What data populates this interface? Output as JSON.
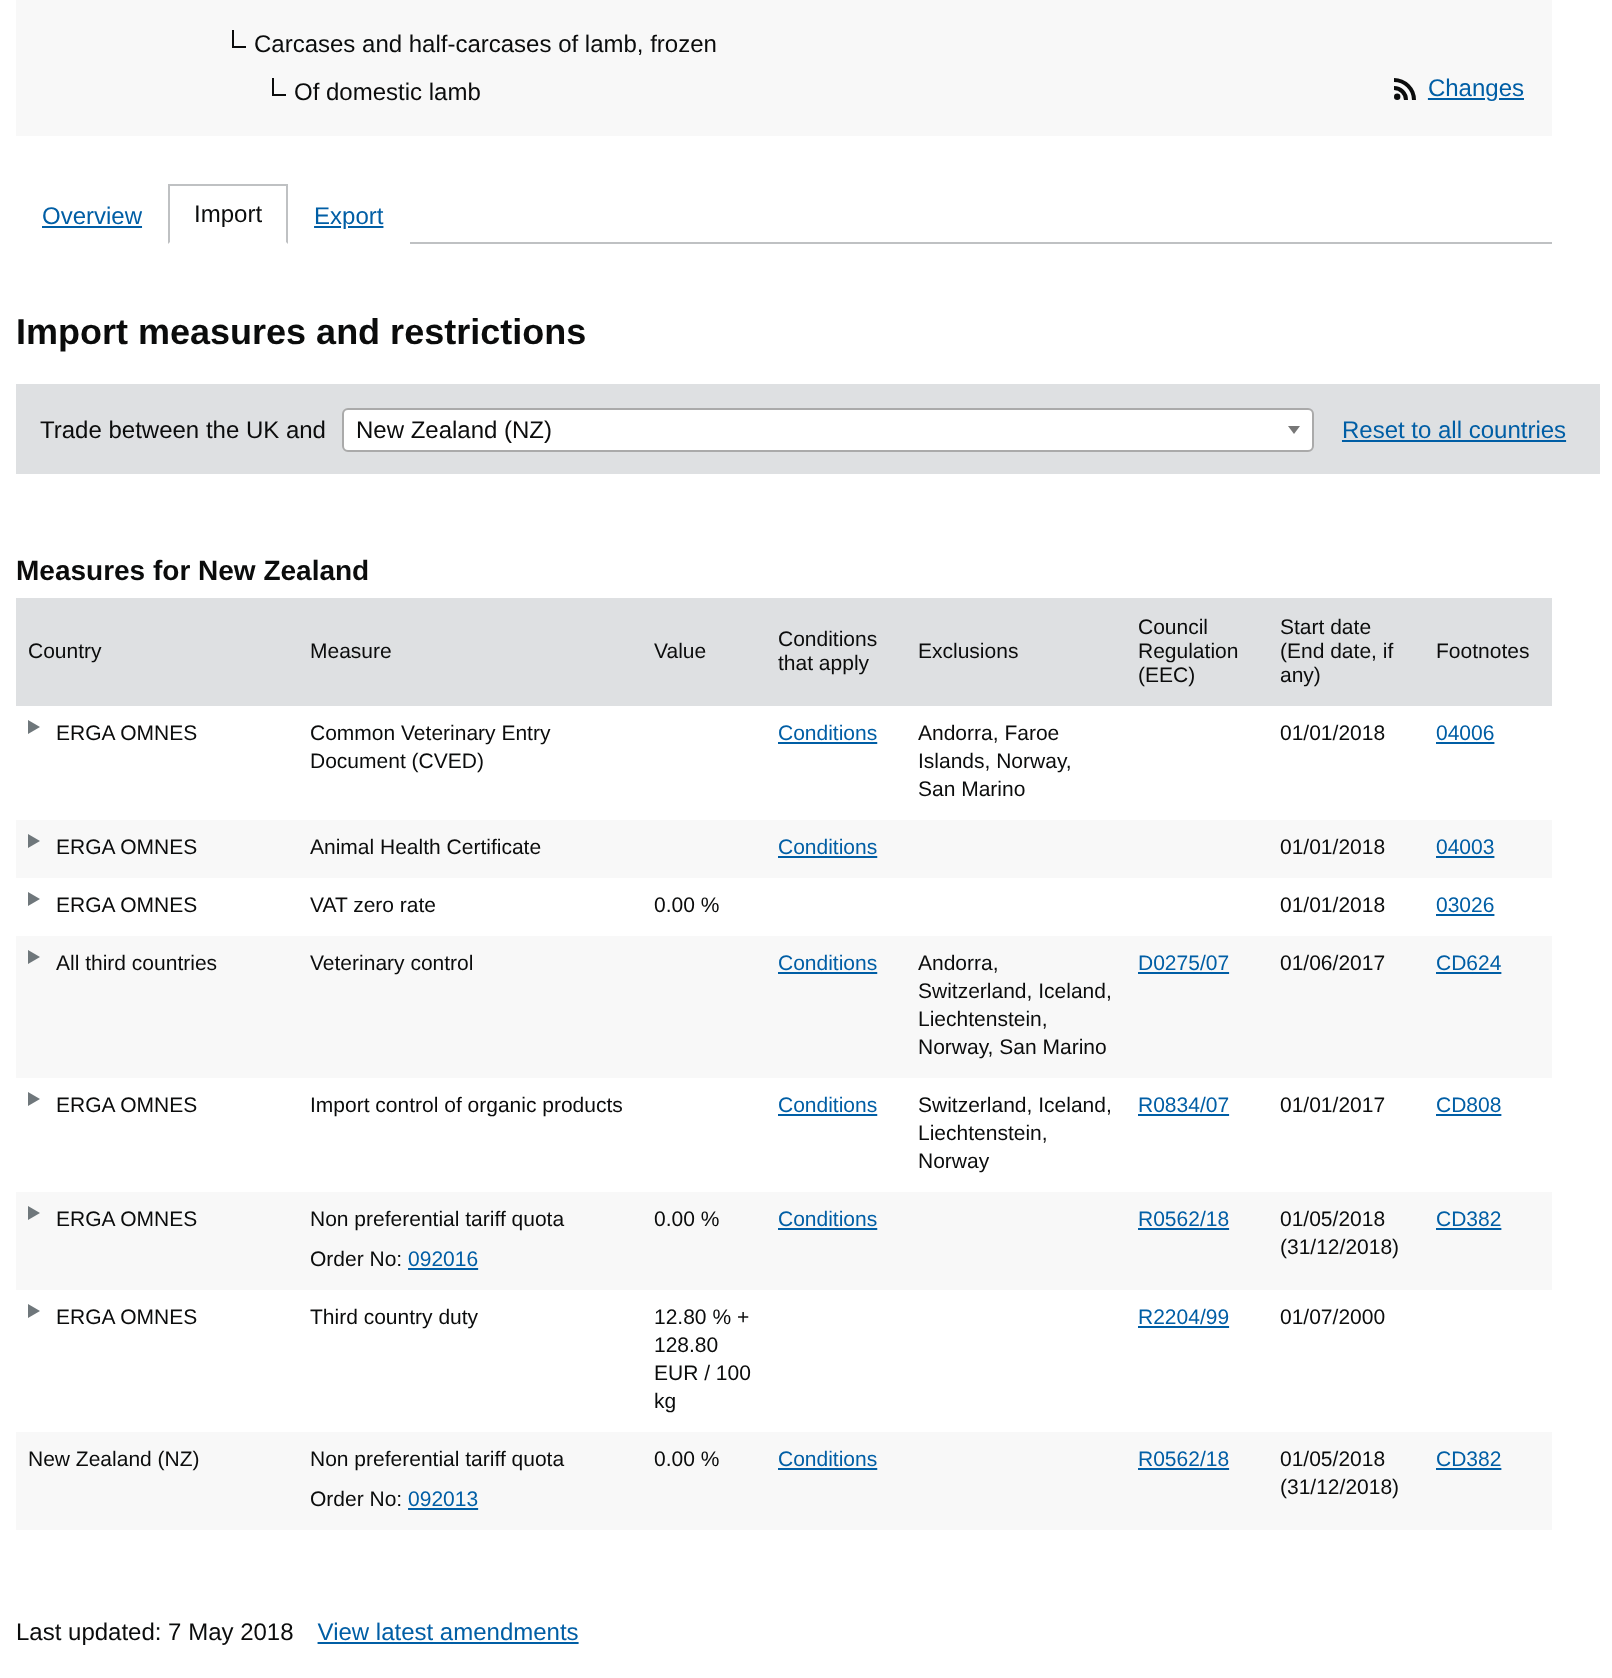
{
  "breadcrumb": [
    {
      "text": "Carcases and half-carcases of lamb, frozen"
    },
    {
      "text": "Of domestic lamb"
    }
  ],
  "changes_link": "Changes",
  "tabs": [
    {
      "label": "Overview",
      "selected": false
    },
    {
      "label": "Import",
      "selected": true
    },
    {
      "label": "Export",
      "selected": false
    }
  ],
  "heading": "Import measures and restrictions",
  "filter": {
    "label": "Trade between the UK and",
    "value": "New Zealand (NZ)",
    "reset_link": "Reset to all countries"
  },
  "measures_heading": "Measures for New Zealand",
  "table": {
    "columns": [
      "Country",
      "Measure",
      "Value",
      "Conditions that apply",
      "Exclusions",
      "Council Regulation (EEC)",
      "Start date (End date, if any)",
      "Footnotes"
    ],
    "rows": [
      {
        "expandable": true,
        "country": "ERGA OMNES",
        "measure": "Common Veterinary Entry Document (CVED)",
        "value": "",
        "conditions": "Conditions",
        "exclusions": "Andorra, Faroe Islands, Norway, San Marino",
        "regulation": "",
        "start_date": "01/01/2018",
        "footnote": "04006"
      },
      {
        "expandable": true,
        "country": "ERGA OMNES",
        "measure": "Animal Health Certificate",
        "value": "",
        "conditions": "Conditions",
        "exclusions": "",
        "regulation": "",
        "start_date": "01/01/2018",
        "footnote": "04003"
      },
      {
        "expandable": true,
        "country": "ERGA OMNES",
        "measure": "VAT zero rate",
        "value": "0.00 %",
        "conditions": "",
        "exclusions": "",
        "regulation": "",
        "start_date": "01/01/2018",
        "footnote": "03026"
      },
      {
        "expandable": true,
        "country": "All third countries",
        "measure": "Veterinary control",
        "value": "",
        "conditions": "Conditions",
        "exclusions": "Andorra, Switzerland, Iceland, Liechtenstein, Norway, San Marino",
        "regulation": "D0275/07",
        "start_date": "01/06/2017",
        "footnote": "CD624"
      },
      {
        "expandable": true,
        "country": "ERGA OMNES",
        "measure": "Import control of organic products",
        "value": "",
        "conditions": "Conditions",
        "exclusions": "Switzerland, Iceland, Liechtenstein, Norway",
        "regulation": "R0834/07",
        "start_date": "01/01/2017",
        "footnote": "CD808"
      },
      {
        "expandable": true,
        "country": "ERGA OMNES",
        "measure": "Non preferential tariff quota",
        "order_label": "Order No:",
        "order_no": "092016",
        "value": "0.00 %",
        "conditions": "Conditions",
        "exclusions": "",
        "regulation": "R0562/18",
        "start_date": "01/05/2018",
        "end_date": "(31/12/2018)",
        "footnote": "CD382"
      },
      {
        "expandable": true,
        "country": "ERGA OMNES",
        "measure": "Third country duty",
        "value": "12.80 % + 128.80 EUR / 100 kg",
        "conditions": "",
        "exclusions": "",
        "regulation": "R2204/99",
        "start_date": "01/07/2000",
        "footnote": ""
      },
      {
        "expandable": false,
        "country": "New Zealand (NZ)",
        "measure": "Non preferential tariff quota",
        "order_label": "Order No:",
        "order_no": "092013",
        "value": "0.00 %",
        "conditions": "Conditions",
        "exclusions": "",
        "regulation": "R0562/18",
        "start_date": "01/05/2018",
        "end_date": "(31/12/2018)",
        "footnote": "CD382"
      }
    ]
  },
  "footer": {
    "text": "Last updated: 7 May 2018",
    "link": "View latest amendments"
  }
}
